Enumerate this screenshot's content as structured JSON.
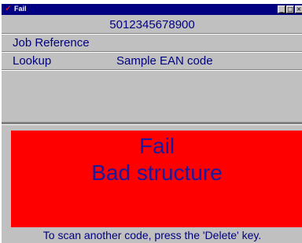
{
  "window": {
    "title": "Fail",
    "check_icon": "✓",
    "buttons": {
      "minimize": "_",
      "maximize": "□",
      "close": "×"
    }
  },
  "barcode": "5012345678900",
  "fields": {
    "job_reference_label": "Job Reference",
    "lookup_label": "Lookup",
    "lookup_value": "Sample EAN code"
  },
  "result": {
    "status": "Fail",
    "message": "Bad structure",
    "background_color": "#ff0000"
  },
  "instruction": "To scan another code, press the 'Delete' key."
}
